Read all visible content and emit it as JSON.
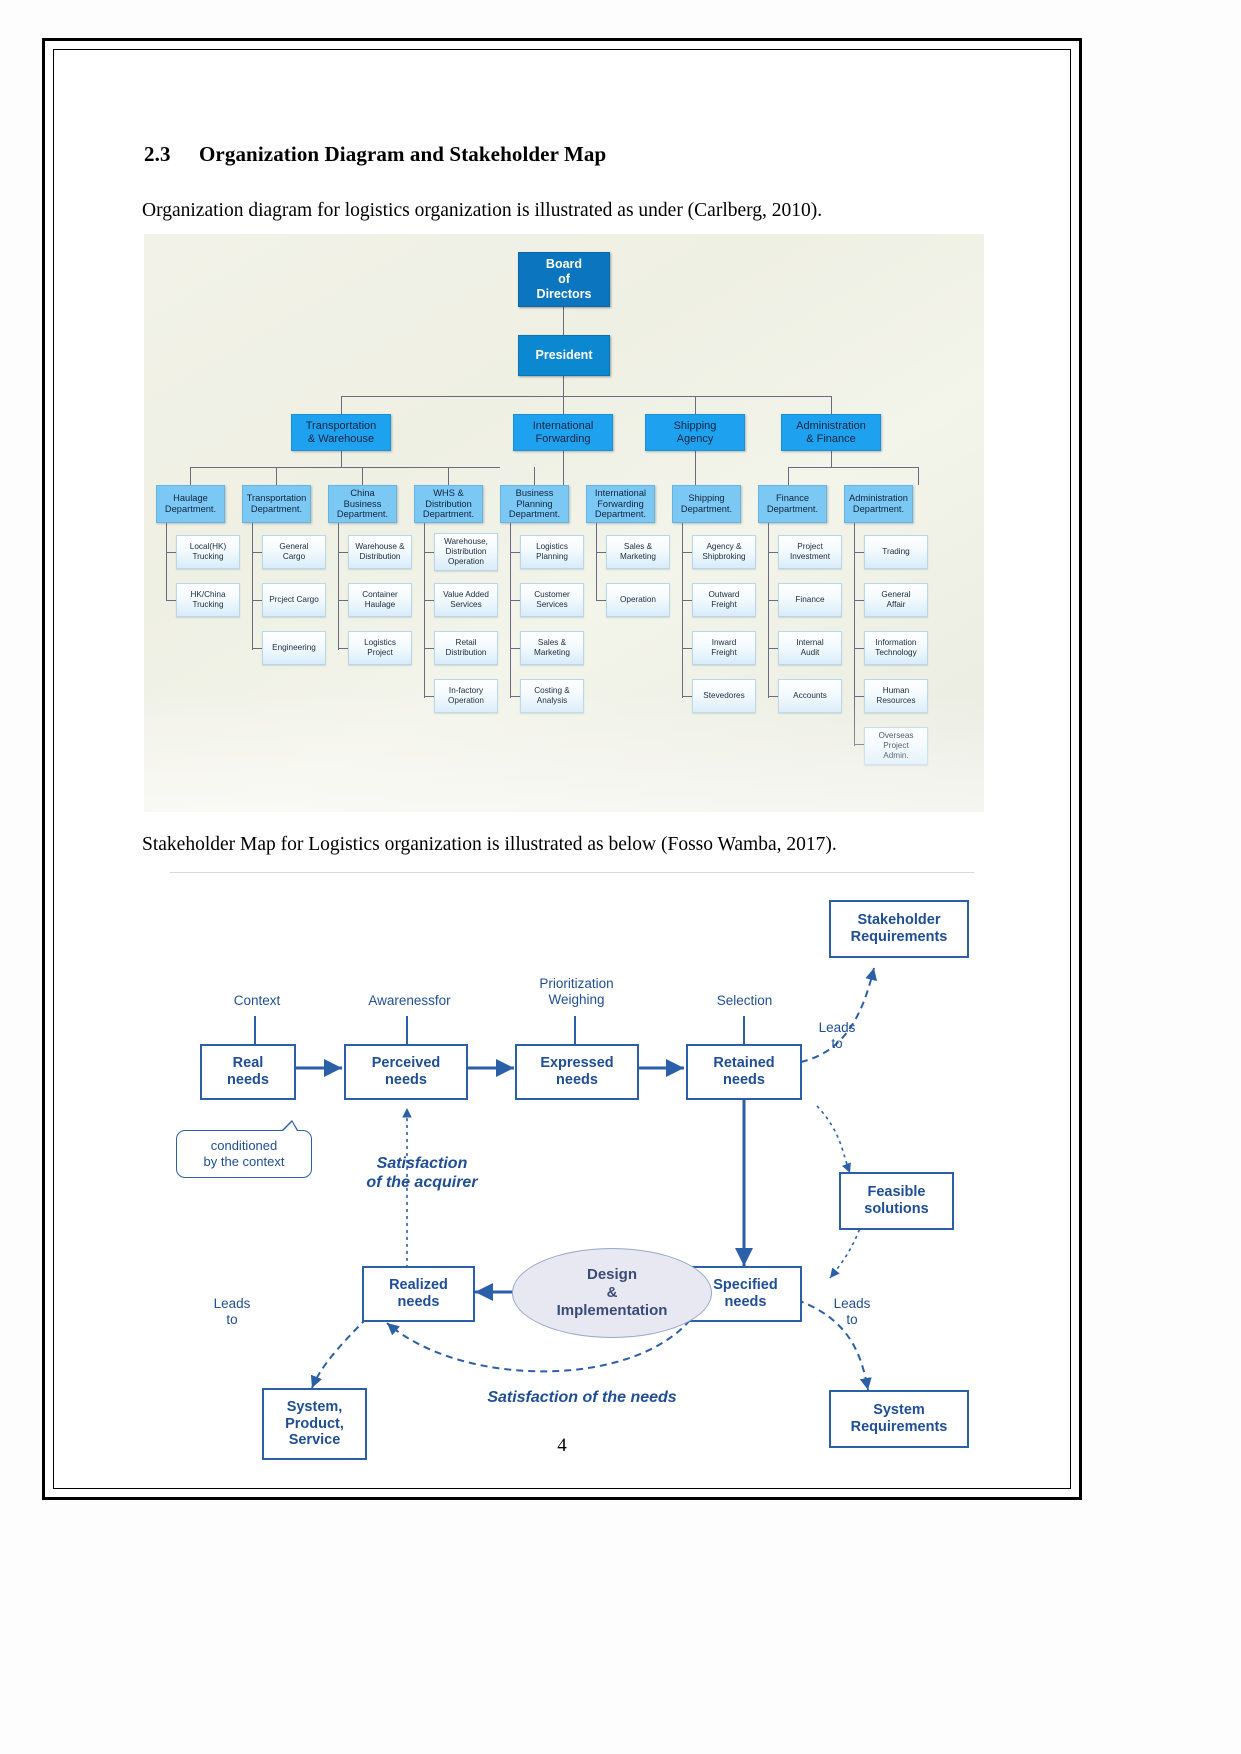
{
  "document": {
    "section_number": "2.3",
    "section_title": "Organization Diagram and Stakeholder Map",
    "paragraph_1": "Organization diagram for logistics organization is illustrated as under (Carlberg, 2010).",
    "paragraph_2": "Stakeholder Map for Logistics organization is illustrated as below (Fosso Wamba, 2017).",
    "page_number": "4"
  },
  "org_chart": {
    "board": "Board\nof\nDirectors",
    "president": "President",
    "divisions": [
      "Transportation\n& Warehouse",
      "International\nForwarding",
      "Shipping\nAgency",
      "Administration\n& Finance"
    ],
    "departments": [
      "Haulage\nDepartment.",
      "Transportation\nDepartment.",
      "China\nBusiness\nDepartment.",
      "WHS &\nDistribution\nDepartment.",
      "Business\nPlanning\nDepartment.",
      "International\nForwarding\nDepartment.",
      "Shipping\nDepartment.",
      "Finance\nDepartment.",
      "Administration\nDepartment."
    ],
    "units": {
      "haulage": [
        "Local(HK)\nTrucking",
        "HK/China\nTrucking"
      ],
      "transportation": [
        "General\nCargo",
        "Prcject Cargo",
        "Engineering"
      ],
      "china_business": [
        "Warehouse &\nDistribution",
        "Container\nHaulage",
        "Logistics\nProject"
      ],
      "whs_distribution": [
        "Warehouse,\nDistribution\nOperation",
        "Value Added\nServices",
        "Retail\nDistribution",
        "In-factory\nOperation"
      ],
      "business_planning": [
        "Logistics\nPlanning",
        "Customer\nServices",
        "Sales &\nMarketing",
        "Costing &\nAnalysis"
      ],
      "international_forwarding": [
        "Sales &\nMarketing",
        "Operation"
      ],
      "shipping": [
        "Agency &\nShipbroking",
        "Outward\nFreight",
        "Inward\nFreight",
        "Stevedores"
      ],
      "finance": [
        "Project\nInvestment",
        "Finance",
        "Internal\nAudit",
        "Accounts"
      ],
      "administration": [
        "Trading",
        "General\nAffair",
        "Information\nTechnology",
        "Human\nResources",
        "Overseas\nProject\nAdmin."
      ]
    },
    "colors": {
      "level1": "#0b76bf",
      "level2": "#0b88d0",
      "level3": "#1ea2f0",
      "level4": "#7cc8f5",
      "level5": "#eaf4fc",
      "connector": "#6a6a80",
      "background": "#f0f1e6"
    }
  },
  "stakeholder_map": {
    "boxes": {
      "real_needs": "Real\nneeds",
      "perceived_needs": "Perceived\nneeds",
      "expressed_needs": "Expressed\nneeds",
      "retained_needs": "Retained\nneeds",
      "stakeholder_requirements": "Stakeholder\nRequirements",
      "feasible_solutions": "Feasible\nsolutions",
      "specified_needs": "Specified\nneeds",
      "system_requirements": "System\nRequirements",
      "realized_needs": "Realized\nneeds",
      "system_product_service": "System,\nProduct,\nService"
    },
    "ellipse": "Design\n&\nImplementation",
    "callout": "conditioned\nby the context",
    "labels": {
      "context": "Context",
      "awareness_for": "Awarenessfor",
      "prioritization_weighing": "Prioritization\nWeighing",
      "selection": "Selection",
      "leads_to_1": "Leads\nto",
      "leads_to_2": "Leads\nto",
      "leads_to_3": "Leads\nto"
    },
    "italic_labels": {
      "satisfaction_acquirer": "Satisfaction\nof the acquirer",
      "satisfaction_needs": "Satisfaction of the needs"
    },
    "colors": {
      "stroke": "#2b5fa8",
      "text": "#1f4e96",
      "ellipse_fill": "#e8e8f2"
    }
  }
}
